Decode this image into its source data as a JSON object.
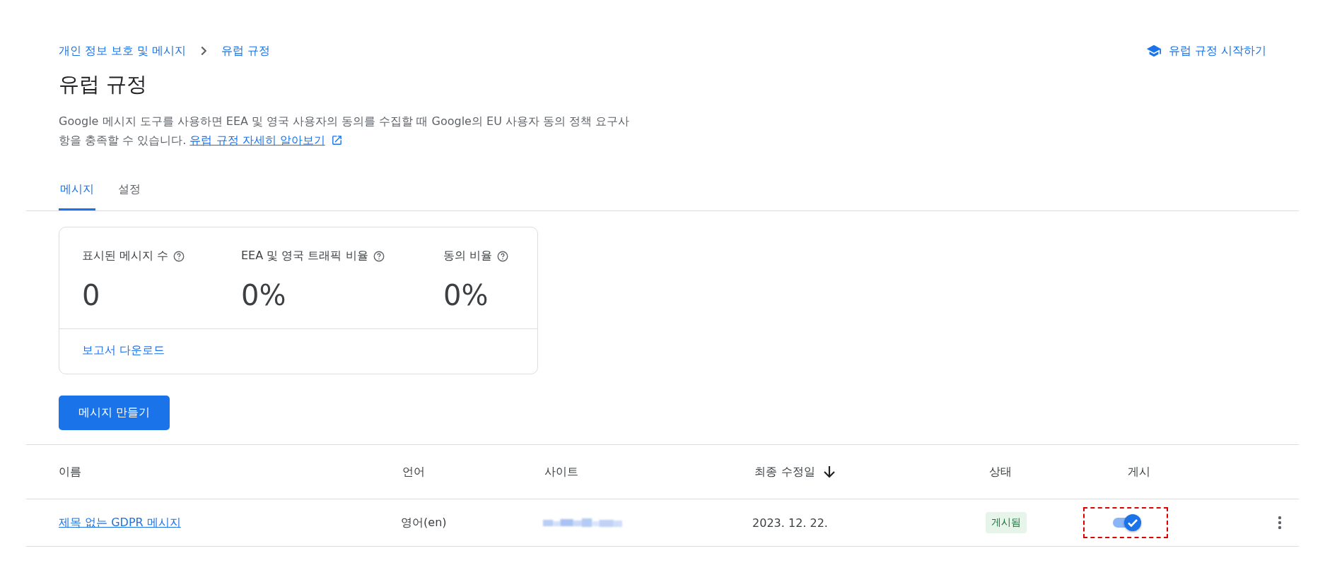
{
  "breadcrumb": [
    "개인 정보 보호 및 메시지",
    "유럽 규정"
  ],
  "start_link": "유럽 규정 시작하기",
  "title": "유럽 규정",
  "description": "Google 메시지 도구를 사용하면 EEA 및 영국 사용자의 동의를 수집할 때 Google의 EU 사용자 동의 정책 요구사항을 충족할 수 있습니다.",
  "learn_more_link": "유럽 규정 자세히 알아보기",
  "tabs": [
    {
      "label": "메시지",
      "selected": true
    },
    {
      "label": "설정",
      "selected": false
    }
  ],
  "stats": [
    {
      "label": "표시된 메시지 수",
      "value": "0"
    },
    {
      "label": "EEA 및 영국 트래픽 비율",
      "value": "0%"
    },
    {
      "label": "동의 비율",
      "value": "0%"
    }
  ],
  "download_link": "보고서 다운로드",
  "create_button": "메시지 만들기",
  "table": {
    "columns": [
      {
        "label": "이름",
        "sorted": false
      },
      {
        "label": "언어",
        "sorted": false
      },
      {
        "label": "사이트",
        "sorted": false
      },
      {
        "label": "최종 수정일",
        "sorted": true
      },
      {
        "label": "상태",
        "sorted": false
      },
      {
        "label": "게시",
        "sorted": false
      }
    ],
    "rows": [
      {
        "name": "제목 없는 GDPR 메시지",
        "language": "영어(en)",
        "site_redacted": true,
        "modified": "2023. 12. 22.",
        "status": "게시됨",
        "published": true,
        "highlighted": true
      }
    ]
  }
}
